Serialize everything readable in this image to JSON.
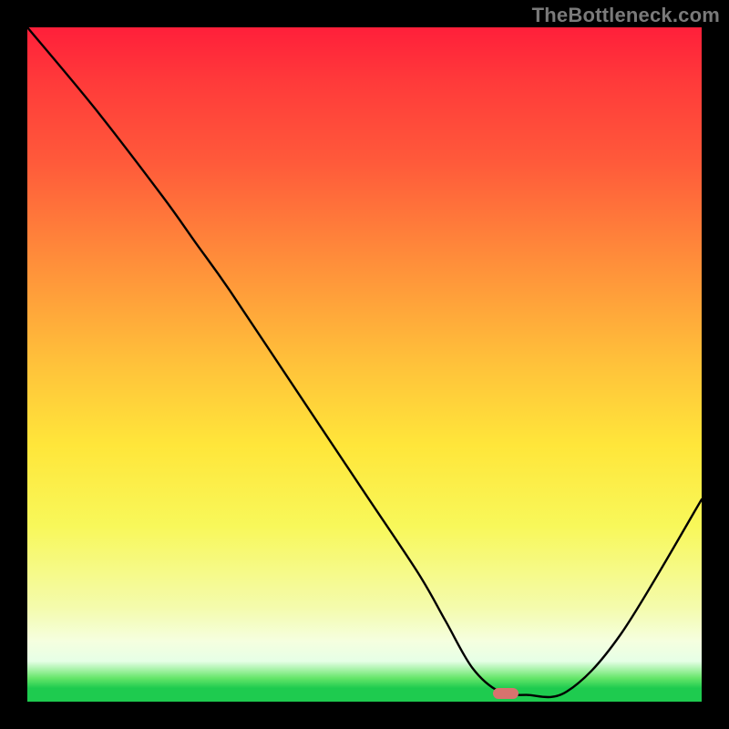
{
  "watermark": "TheBottleneck.com",
  "chart_data": {
    "type": "line",
    "title": "",
    "xlabel": "",
    "ylabel": "",
    "xlim": [
      0,
      100
    ],
    "ylim": [
      0,
      100
    ],
    "grid": false,
    "series": [
      {
        "name": "bottleneck-curve",
        "x": [
          0,
          10,
          20,
          25,
          30,
          40,
          50,
          58,
          62,
          66,
          70,
          74,
          80,
          88,
          100
        ],
        "y": [
          100,
          88,
          75,
          68,
          61,
          46,
          31,
          19,
          12,
          5,
          1.5,
          1,
          1.5,
          10,
          30
        ]
      }
    ],
    "marker": {
      "x": 71,
      "y": 1.2
    },
    "background": "red-yellow-green-gradient"
  }
}
